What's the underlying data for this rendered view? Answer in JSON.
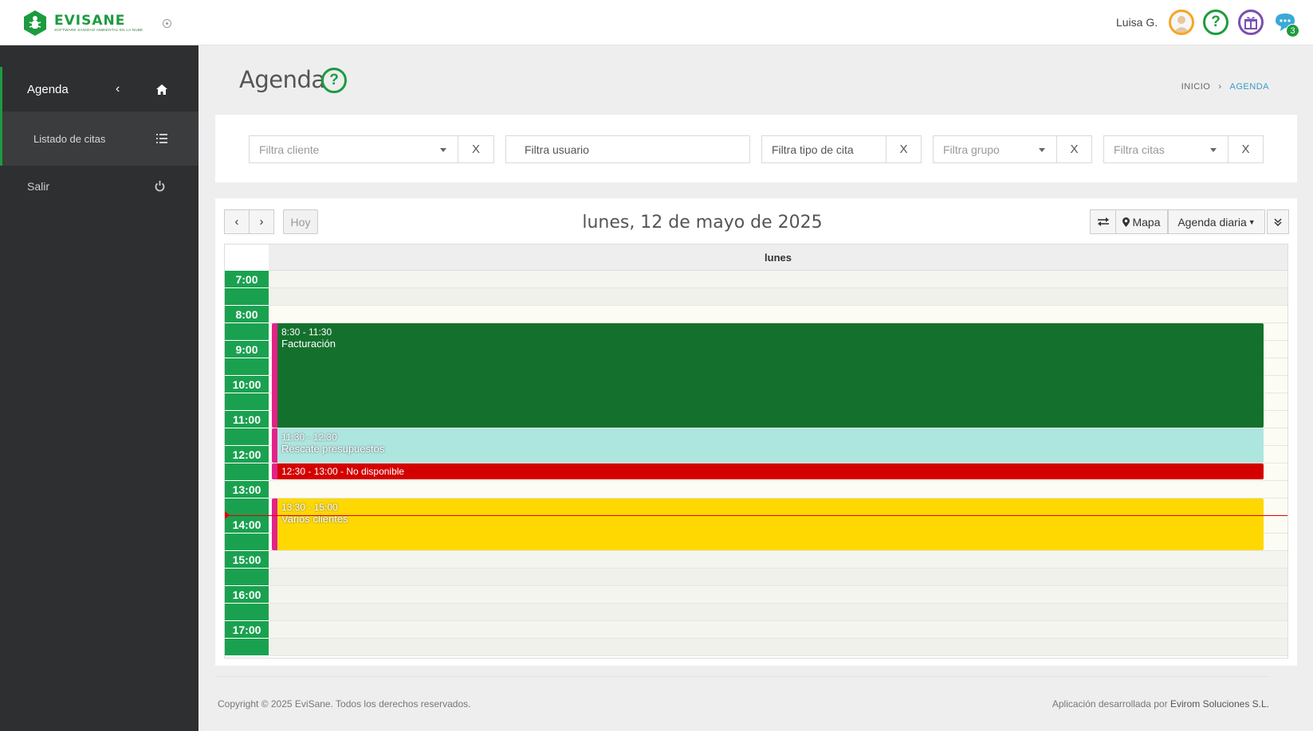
{
  "app": {
    "logo_name": "EVISANE",
    "logo_tagline": "SOFTWARE SANIDAD AMBIENTAL EN LA NUBE"
  },
  "header": {
    "user_name": "Luisa G.",
    "help_glyph": "?",
    "chat_badge": "3",
    "icons": [
      "avatar-icon",
      "help-icon",
      "gift-icon",
      "chat-icon"
    ]
  },
  "sidebar": {
    "items": [
      {
        "label": "Agenda",
        "icon": "home-icon"
      },
      {
        "label": "Listado de citas",
        "icon": "list-icon"
      },
      {
        "label": "Salir",
        "icon": "power-icon"
      }
    ]
  },
  "page": {
    "title": "Agenda",
    "breadcrumb": [
      "INICIO",
      "AGENDA"
    ]
  },
  "filters": {
    "cliente": "Filtra cliente",
    "usuario": "Filtra usuario",
    "tipo": "Filtra tipo de cita",
    "grupo": "Filtra grupo",
    "citas": "Filtra citas",
    "clear": "X"
  },
  "calendar": {
    "today_label": "Hoy",
    "date_title": "lunes, 12 de mayo de 2025",
    "day_header": "lunes",
    "map_label": "Mapa",
    "view_label": "Agenda diaria",
    "hours": [
      "7:00",
      "8:00",
      "9:00",
      "10:00",
      "11:00",
      "12:00",
      "13:00",
      "14:00",
      "15:00",
      "16:00",
      "17:00"
    ],
    "events": [
      {
        "time": "8:30 - 11:30",
        "title": "Facturación",
        "color": "#14712d"
      },
      {
        "time": "11:30 - 12:30",
        "title": "Rescate presupuestos",
        "color": "#ade5df"
      },
      {
        "label": "12:30 - 13:00 - No disponible",
        "color": "#d40000"
      },
      {
        "time": "13:30 - 15:00",
        "title": "Varios clientes",
        "color": "#ffd801"
      }
    ]
  },
  "footer": {
    "copyright": "Copyright © 2025 EviSane. Todos los derechos reservados.",
    "developed_by": "Aplicación desarrollada por",
    "company": "Evirom Soluciones S.L."
  },
  "colors": {
    "brand_green": "#1d9b3f",
    "time_column": "#1aa150",
    "event_border": "#e32288",
    "sidebar_bg": "#2d2f30",
    "link_blue": "#3a9bc7"
  }
}
